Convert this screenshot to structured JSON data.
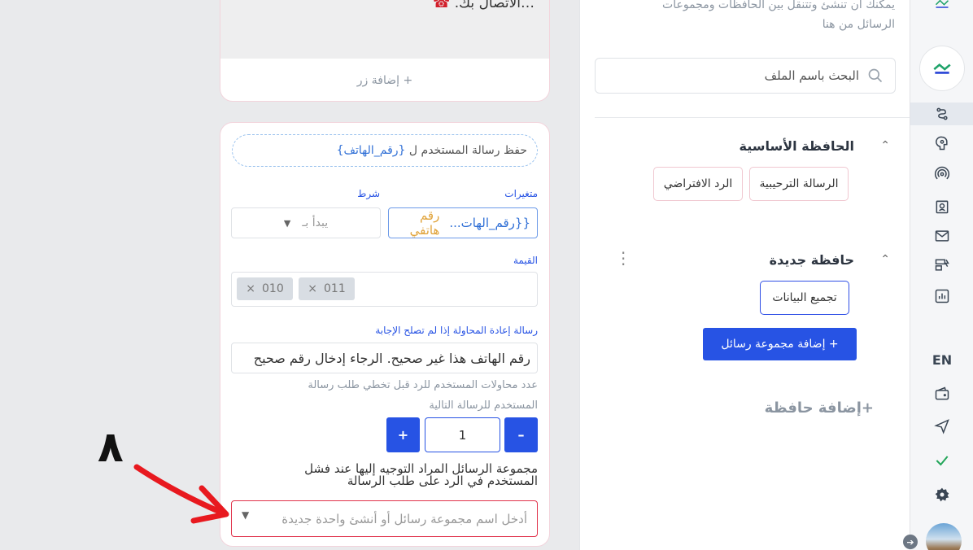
{
  "editor": {
    "message_text": "…الاتصال بك.",
    "add_button_label": "+ إضافة زر",
    "save_field_prefix": "حفظ رسالة المستخدم ل ",
    "save_field_var": "{رقم_الهاتف}",
    "variables_label": "متغيرات",
    "condition_label": "شرط",
    "variable_value": "{{رقم_الهات...",
    "variable_hint": "رقم هاتفي",
    "condition_value": "يبدأ بـ",
    "value_label": "القيمة",
    "tags": [
      "010",
      "011"
    ],
    "retry_label": "رسالة إعادة المحاولة إذا لم تصلح الإجابة",
    "retry_value": "رقم الهاتف هذا غير صحيح. الرجاء إدخال رقم صحيح",
    "attempts_hint_1": "عدد محاولات المستخدم للرد قبل تخطي طلب رسالة",
    "attempts_hint_2": "المستخدم للرسالة التالية",
    "attempts_value": "1",
    "plus": "+",
    "minus": "–",
    "fallback_label_1": "مجموعة الرسائل المراد التوجيه إليها عند فشل",
    "fallback_label_2": "المستخدم في الرد على طلب الرسالة",
    "fallback_placeholder": "أدخل اسم مجموعة رسائل أو أنشئ واحدة جديدة"
  },
  "folders": {
    "intro": "يمكنك ان تنشئ وتتنقل بين الحافظات ومجموعات الرسائل من هنا",
    "search_placeholder": "البحث باسم الملف",
    "main_folder": "الحافظة الأساسية",
    "main_chips": [
      "الرسالة الترحيبية",
      "الرد الافتراضي"
    ],
    "new_folder": "حافظة جديدة",
    "new_chips": [
      "تجميع البيانات"
    ],
    "add_group": "+ إضافة مجموعة رسائل",
    "add_folder": "+إضافة حافظة"
  },
  "rail": {
    "lang": "EN"
  },
  "annotation": {
    "step_number": "٨"
  },
  "colors": {
    "accent": "#2753e4",
    "error": "#e0324b",
    "arrow": "#e8191f"
  }
}
